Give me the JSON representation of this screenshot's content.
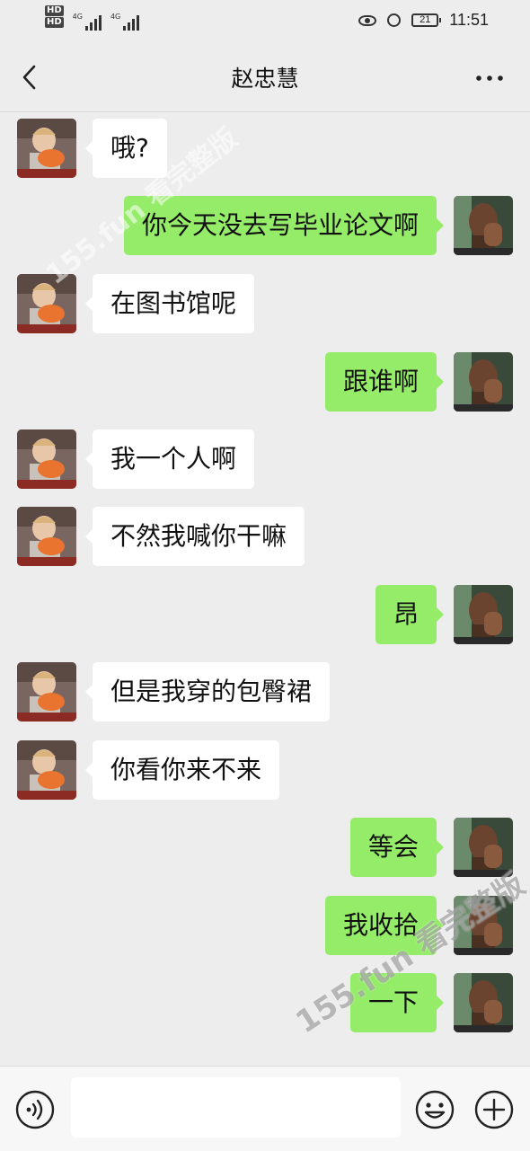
{
  "status_bar": {
    "hd1": "HD",
    "hd2": "HD",
    "net1": "4G",
    "net2": "4G",
    "battery": "21",
    "time": "11:51"
  },
  "header": {
    "title": "赵忠慧"
  },
  "messages": [
    {
      "side": "left",
      "text": "哦?"
    },
    {
      "side": "right",
      "text": "你今天没去写毕业论文啊"
    },
    {
      "side": "left",
      "text": "在图书馆呢"
    },
    {
      "side": "right",
      "text": "跟谁啊"
    },
    {
      "side": "left",
      "text": "我一个人啊"
    },
    {
      "side": "left",
      "text": "不然我喊你干嘛"
    },
    {
      "side": "right",
      "text": "昂"
    },
    {
      "side": "left",
      "text": "但是我穿的包臀裙"
    },
    {
      "side": "left",
      "text": "你看你来不来"
    },
    {
      "side": "right",
      "text": "等会"
    },
    {
      "side": "right",
      "text": "我收拾"
    },
    {
      "side": "right",
      "text": "一下"
    }
  ],
  "watermarks": {
    "top": "155.fun 看完整版",
    "bottom": "155.fun 看完整版"
  },
  "input": {
    "value": "",
    "placeholder": ""
  },
  "colors": {
    "background": "#ededed",
    "sent_bubble": "#95ec69",
    "received_bubble": "#ffffff",
    "input_bar": "#f7f7f7"
  }
}
